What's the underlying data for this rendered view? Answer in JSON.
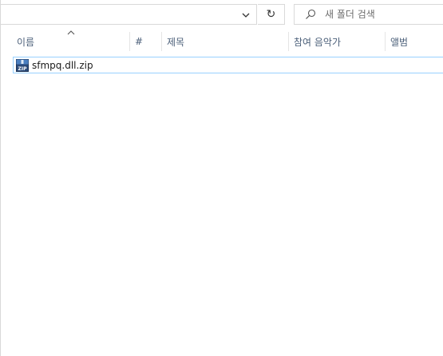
{
  "toolbar": {
    "address_value": "",
    "refresh_glyph": "↻",
    "search_placeholder": "새 폴더 검색"
  },
  "columns": [
    {
      "label": "이름"
    },
    {
      "label": "#"
    },
    {
      "label": "제목"
    },
    {
      "label": "참여 음악가"
    },
    {
      "label": "앨범"
    }
  ],
  "sort": {
    "column": "이름",
    "direction": "ascending"
  },
  "files": [
    {
      "name": "sfmpq.dll.zip",
      "icon": "zip-archive-icon"
    }
  ],
  "colors": {
    "header_text": "#4c607a",
    "selection_border": "#99d1ff",
    "border": "#d9d9d9"
  }
}
